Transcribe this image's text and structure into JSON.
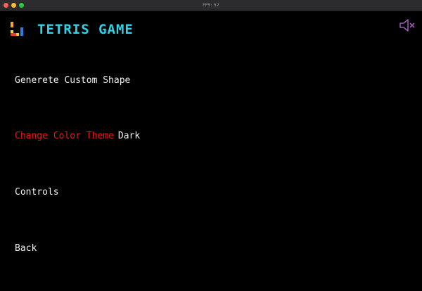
{
  "window": {
    "title": "FPS: 52"
  },
  "header": {
    "title": "TETRIS GAME",
    "logo_icon": "tetromino-logo-icon",
    "sound_icon": "speaker-muted-icon",
    "title_color": "#2fd3e7"
  },
  "menu": {
    "items": [
      {
        "label": "Generete Custom Shape",
        "value": "",
        "selected": false
      },
      {
        "label": "Change Color Theme",
        "value": "Dark",
        "selected": true
      },
      {
        "label": "Controls",
        "value": "",
        "selected": false
      },
      {
        "label": "Back",
        "value": "",
        "selected": false
      }
    ],
    "selected_color": "#e51a1a",
    "text_color": "#f2f2f2"
  }
}
